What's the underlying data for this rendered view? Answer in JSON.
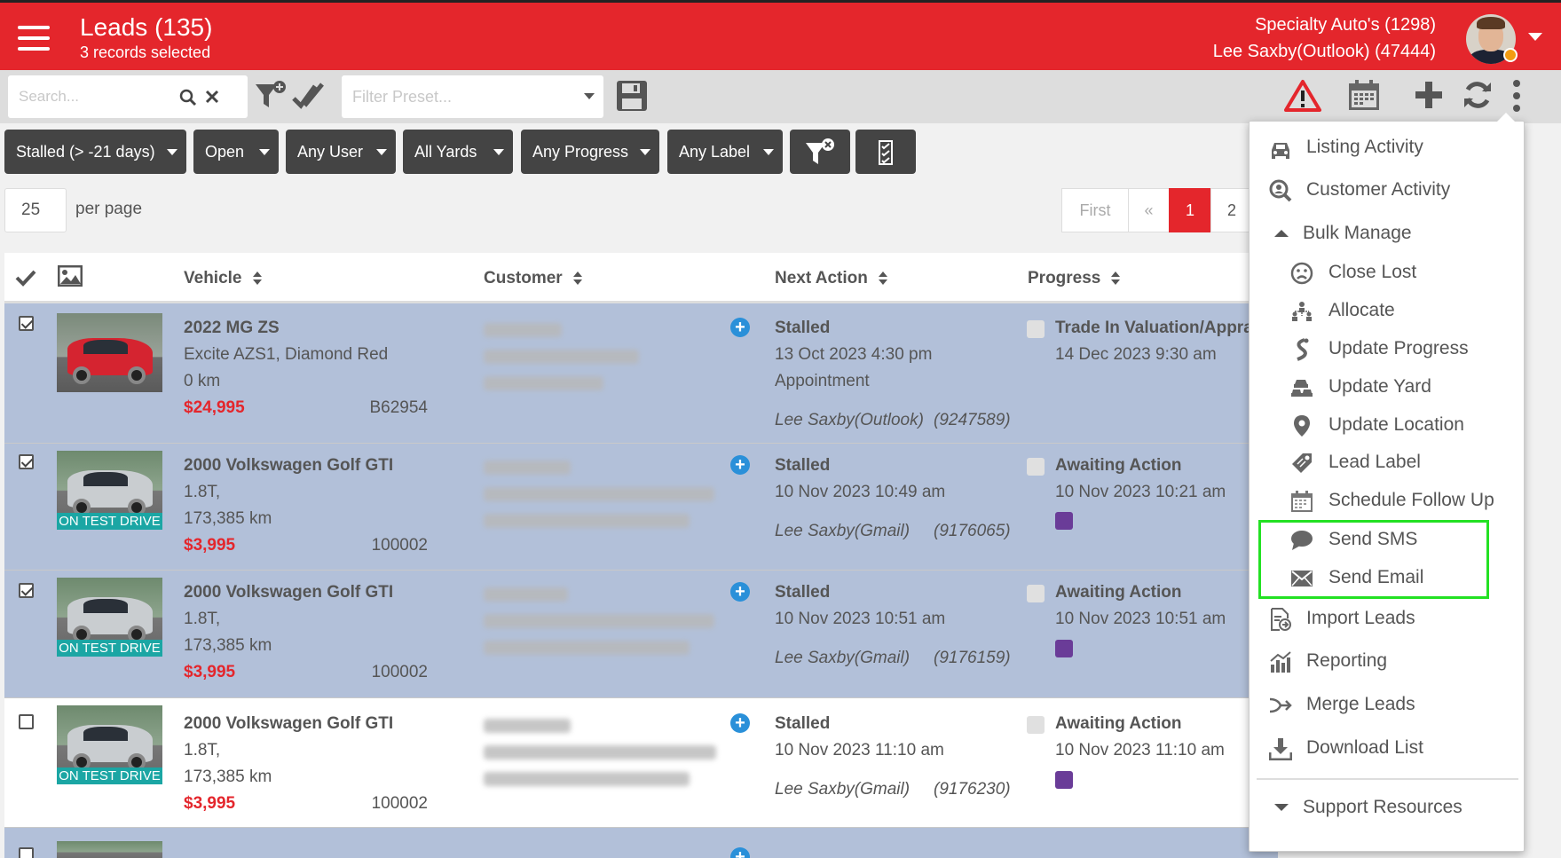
{
  "header": {
    "title": "Leads (135)",
    "subtitle": "3 records selected",
    "dealer": "Specialty Auto's (1298)",
    "user": "Lee Saxby(Outlook) (47444)"
  },
  "toolbar": {
    "search_placeholder": "Search...",
    "filter_preset_placeholder": "Filter Preset..."
  },
  "filters": [
    "Stalled (> -21 days)",
    "Open",
    "Any User",
    "All Yards",
    "Any Progress",
    "Any Label"
  ],
  "pagination": {
    "per_page_value": "25",
    "per_page_label": "per page",
    "first": "First",
    "prev": "«",
    "current": "1",
    "next_page": "2"
  },
  "columns": {
    "vehicle": "Vehicle",
    "customer": "Customer",
    "next_action": "Next Action",
    "progress": "Progress"
  },
  "rows": [
    {
      "selected": true,
      "vehicle": {
        "title": "2022 MG ZS",
        "detail": "Excite AZS1, Diamond Red",
        "km": "0 km",
        "price": "$24,995",
        "stock": "B62954",
        "badge": ""
      },
      "next_action": {
        "status": "Stalled",
        "date": "13 Oct 2023 4:30 pm",
        "type": "Appointment",
        "assignee": "Lee Saxby(Outlook)",
        "assignee_id": "(9247589)"
      },
      "progress": {
        "status": "Trade In Valuation/Appra...",
        "date": "14 Dec 2023 9:30 am",
        "label_color": ""
      }
    },
    {
      "selected": true,
      "vehicle": {
        "title": "2000 Volkswagen Golf GTI",
        "detail": "1.8T,",
        "km": "173,385 km",
        "price": "$3,995",
        "stock": "100002",
        "badge": "ON TEST DRIVE"
      },
      "next_action": {
        "status": "Stalled",
        "date": "10 Nov 2023 10:49 am",
        "type": "",
        "assignee": "Lee Saxby(Gmail)",
        "assignee_id": "(9176065)"
      },
      "progress": {
        "status": "Awaiting Action",
        "date": "10 Nov 2023 10:21 am",
        "label_color": "#6a3c98"
      }
    },
    {
      "selected": true,
      "vehicle": {
        "title": "2000 Volkswagen Golf GTI",
        "detail": "1.8T,",
        "km": "173,385 km",
        "price": "$3,995",
        "stock": "100002",
        "badge": "ON TEST DRIVE"
      },
      "next_action": {
        "status": "Stalled",
        "date": "10 Nov 2023 10:51 am",
        "type": "",
        "assignee": "Lee Saxby(Gmail)",
        "assignee_id": "(9176159)"
      },
      "progress": {
        "status": "Awaiting Action",
        "date": "10 Nov 2023 10:51 am",
        "label_color": "#6a3c98"
      }
    },
    {
      "selected": false,
      "vehicle": {
        "title": "2000 Volkswagen Golf GTI",
        "detail": "1.8T,",
        "km": "173,385 km",
        "price": "$3,995",
        "stock": "100002",
        "badge": "ON TEST DRIVE"
      },
      "next_action": {
        "status": "Stalled",
        "date": "10 Nov 2023 11:10 am",
        "type": "",
        "assignee": "Lee Saxby(Gmail)",
        "assignee_id": "(9176230)"
      },
      "progress": {
        "status": "Awaiting Action",
        "date": "10 Nov 2023 11:10 am",
        "label_color": "#6a3c98"
      }
    }
  ],
  "menu": {
    "listing_activity": "Listing Activity",
    "customer_activity": "Customer Activity",
    "bulk_manage": "Bulk Manage",
    "close_lost": "Close Lost",
    "allocate": "Allocate",
    "update_progress": "Update Progress",
    "update_yard": "Update Yard",
    "update_location": "Update Location",
    "lead_label": "Lead Label",
    "schedule_follow_up": "Schedule Follow Up",
    "send_sms": "Send SMS",
    "send_email": "Send Email",
    "import_leads": "Import Leads",
    "reporting": "Reporting",
    "merge_leads": "Merge Leads",
    "download_list": "Download List",
    "support_resources": "Support Resources"
  },
  "colors": {
    "brand_red": "#e4262c",
    "selected_row": "#b2c0d9",
    "highlight": "#23e123",
    "badge_teal": "#1ba6a4",
    "label_purple": "#6a3c98"
  }
}
